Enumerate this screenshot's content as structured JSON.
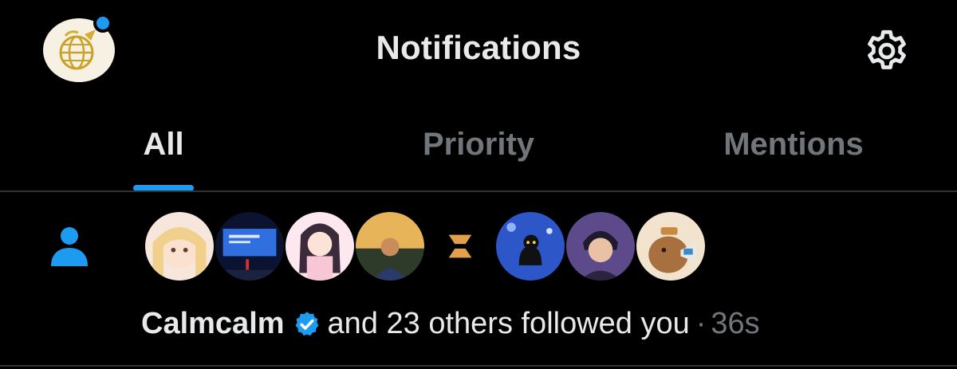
{
  "header": {
    "title": "Notifications",
    "has_unread_dot": true
  },
  "tabs": [
    {
      "label": "All",
      "selected": true
    },
    {
      "label": "Priority",
      "selected": false
    },
    {
      "label": "Mentions",
      "selected": false
    }
  ],
  "notification": {
    "type": "follow",
    "icon": "person-icon",
    "name": "Calmcalm",
    "verified": true,
    "message": "and 23 others followed you",
    "separator": "·",
    "time": "36s",
    "avatars": [
      "avatar-anime-girl-blonde",
      "avatar-presentation-slide",
      "avatar-anime-girl-pink",
      "avatar-man-sunset",
      "avatar-logo-s",
      "avatar-black-cat-blue",
      "avatar-illustrated-boy",
      "avatar-capybara-megaphone"
    ]
  },
  "colors": {
    "background": "#000000",
    "text_primary": "#e7e9ea",
    "text_muted": "#71767b",
    "accent": "#1d9bf0",
    "divider": "#2f3336"
  }
}
